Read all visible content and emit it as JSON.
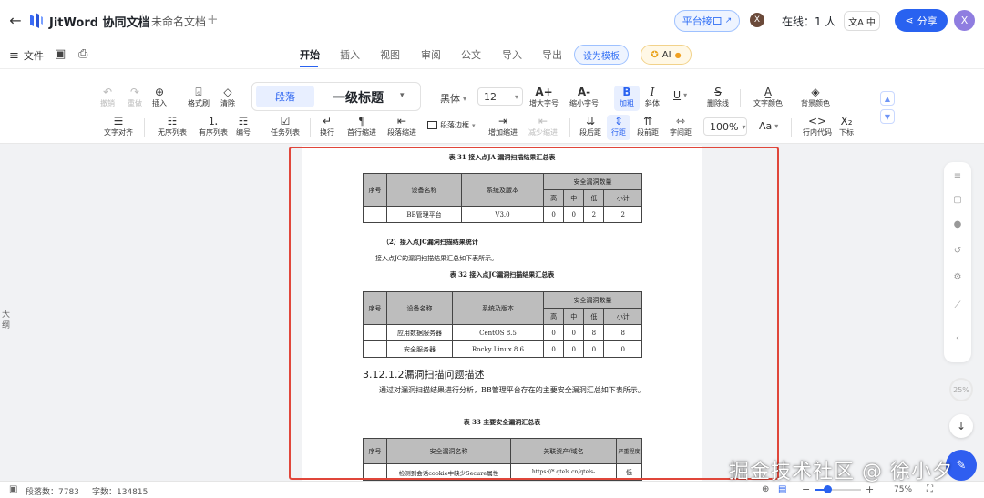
{
  "app": {
    "name": "JitWord 协同文档",
    "doc_title": "未命名文档"
  },
  "header": {
    "api_label": "平台接口",
    "collab_avatar": "X",
    "online_label": "在线：1 人",
    "lang_label": "中",
    "share_label": "分享",
    "user_avatar": "X"
  },
  "menu": {
    "file_label": "文件",
    "tabs": [
      "开始",
      "插入",
      "视图",
      "审阅",
      "公文",
      "导入",
      "导出"
    ],
    "active_tab": "开始",
    "template_label": "设为模板",
    "ai_label": "AI"
  },
  "toolbar": {
    "undo": "撤销",
    "redo": "重做",
    "insert": "插入",
    "format_painter": "格式刷",
    "clear": "清除",
    "style_paragraph": "段落",
    "style_heading": "一级标题",
    "font": "黑体",
    "font_size": "12",
    "grow": "增大字号",
    "shrink": "缩小字号",
    "bold": "加粗",
    "italic": "斜体",
    "underline": "",
    "strike": "删除线",
    "text_color": "文字颜色",
    "bg_color": "背景颜色",
    "align": "文字对齐",
    "bullet": "无序列表",
    "ordered": "有序列表",
    "number": "编号",
    "task": "任务列表",
    "line_break": "换行",
    "first_indent": "首行缩进",
    "para_indent": "段落缩进",
    "para_border": "段落边框",
    "inc_indent": "增加缩进",
    "dec_indent": "减少缩进",
    "space_after": "段后距",
    "line_height": "行距",
    "space_before": "段前距",
    "letter_spacing": "字间距",
    "zoom": "100%",
    "aa": "Aa",
    "inline_code": "行内代码",
    "subscript": "下标",
    "grow_glyph": "A+",
    "shrink_glyph": "A-",
    "bold_glyph": "B",
    "italic_glyph": "I",
    "underline_glyph": "U",
    "sub_glyph": "X₂",
    "code_glyph": "<>"
  },
  "outline_label": "大纲",
  "document": {
    "table31": {
      "caption": "表 31 接入点JA 漏洞扫描结果汇总表",
      "headers": [
        "序号",
        "设备名称",
        "系统及版本",
        "安全漏洞数量"
      ],
      "sub_headers": [
        "高",
        "中",
        "低",
        "小计"
      ],
      "rows": [
        [
          "",
          "BB管理平台",
          "V3.0",
          "0",
          "0",
          "2",
          "2"
        ]
      ]
    },
    "section_jc": "（2）接入点JC漏洞扫描结果统计",
    "jc_intro": "接入点JC的漏洞扫描结果汇总如下表所示。",
    "table32": {
      "caption": "表 32 接入点JC漏洞扫描结果汇总表",
      "headers": [
        "序号",
        "设备名称",
        "系统及版本",
        "安全漏洞数量"
      ],
      "sub_headers": [
        "高",
        "中",
        "低",
        "小计"
      ],
      "rows": [
        [
          "",
          "应用数据服务器",
          "CentOS 8.5",
          "0",
          "0",
          "8",
          "8"
        ],
        [
          "",
          "安全服务器",
          "Rocky Linux 8.6",
          "0",
          "0",
          "0",
          "0"
        ]
      ]
    },
    "heading": "3.12.1.2漏洞扫描问题描述",
    "body": "通过对漏洞扫描结果进行分析，BB管理平台存在的主要安全漏洞汇总如下表所示。",
    "table33": {
      "caption": "表 33 主要安全漏洞汇总表",
      "headers": [
        "序号",
        "安全漏洞名称",
        "关联资产/域名",
        "严重程度"
      ],
      "rows": [
        [
          "",
          "检测到会话cookie中缺少Secure属性",
          "https://*.qtels.cn/qtels-",
          "低"
        ]
      ]
    }
  },
  "side": {
    "zoom_ring": "25%"
  },
  "status": {
    "paragraphs": "段落数：7783",
    "chars": "字数：134815",
    "zoom": "75%",
    "minus": "−",
    "plus": "+"
  },
  "watermark": "掘金技术社区 @ 徐小夕",
  "colors": {
    "accent": "#2962f0",
    "highlight_border": "#e0463a"
  }
}
